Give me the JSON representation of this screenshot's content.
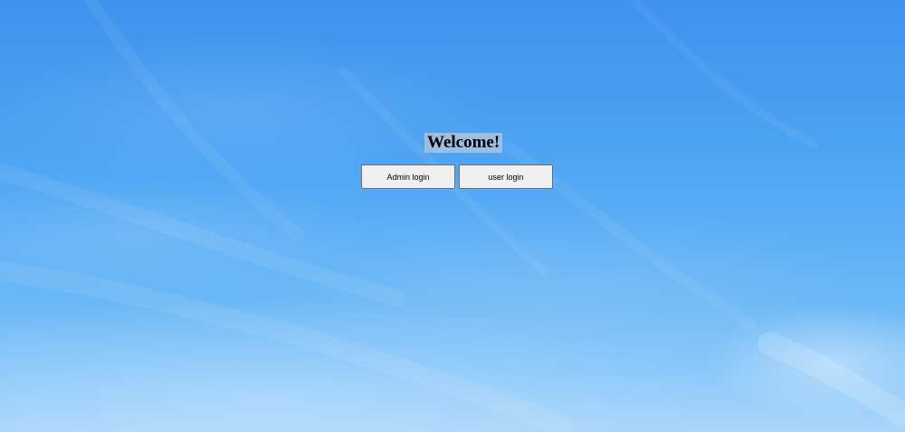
{
  "page": {
    "heading": "Welcome!",
    "background": "blue sky with wispy clouds"
  },
  "buttons": {
    "admin_label": "Admin login",
    "user_label": "user login"
  },
  "colors": {
    "sky_top": "#3f92ef",
    "sky_bottom": "#a9d6fb",
    "button_bg": "#efefef",
    "heading_highlight": "#aac3dc"
  }
}
